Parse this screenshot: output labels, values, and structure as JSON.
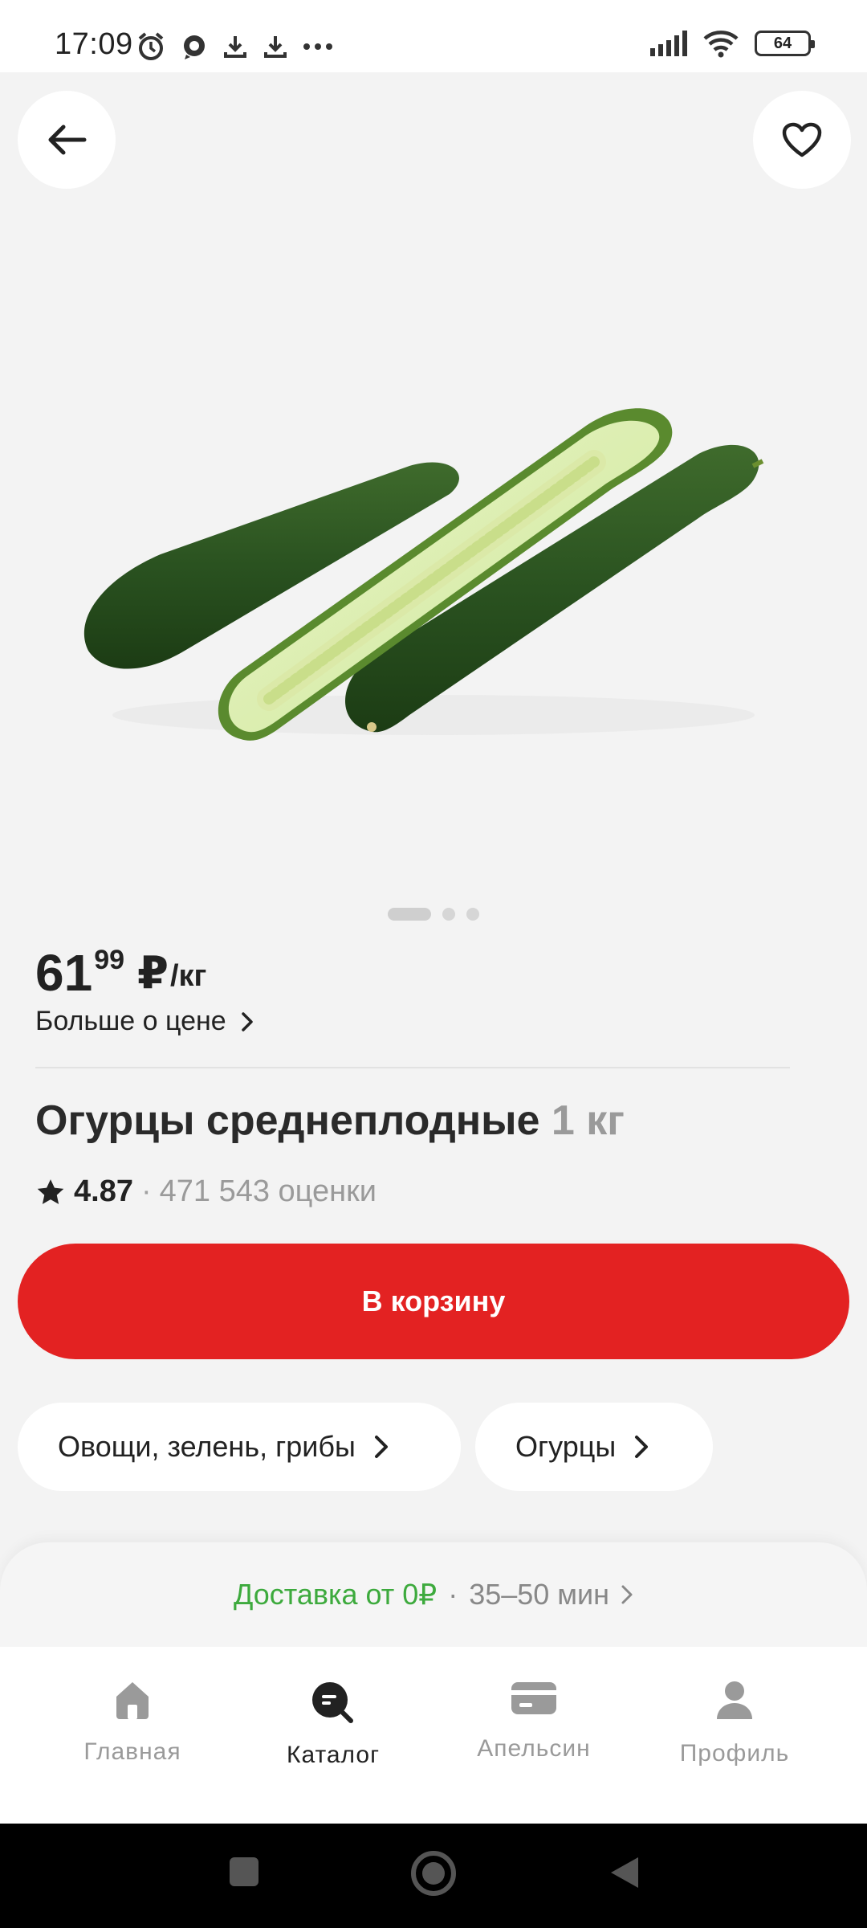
{
  "status_bar": {
    "time": "17:09",
    "battery": "64"
  },
  "product": {
    "price_int": "61",
    "price_frac": "99",
    "currency": "₽",
    "unit": "/кг",
    "more_price_label": "Больше о цене",
    "title": "Огурцы среднеплодные",
    "weight": "1 кг",
    "rating": "4.87",
    "rating_separator": "·",
    "rating_count": "471 543 оценки",
    "gallery": {
      "count": 3,
      "active": 0
    }
  },
  "actions": {
    "cart_label": "В корзину"
  },
  "categories": [
    {
      "label": "Овощи, зелень, грибы"
    },
    {
      "label": "Огурцы"
    }
  ],
  "delivery": {
    "label": "Доставка от 0₽",
    "separator": "·",
    "time": "35–50 мин"
  },
  "nav": {
    "items": [
      {
        "label": "Главная",
        "icon": "home-icon"
      },
      {
        "label": "Каталог",
        "icon": "catalog-search-icon"
      },
      {
        "label": "Апельсин",
        "icon": "card-icon"
      },
      {
        "label": "Профиль",
        "icon": "profile-icon"
      }
    ],
    "active": 1
  },
  "colors": {
    "accent": "#e32222",
    "delivery_green": "#3daa3d",
    "background": "#f3f3f3"
  }
}
